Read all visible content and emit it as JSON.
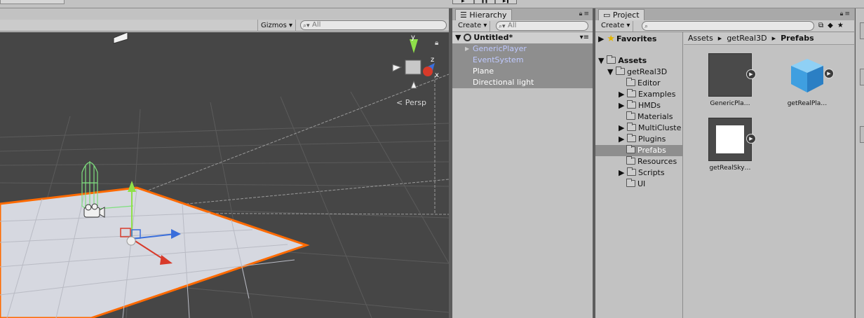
{
  "toolbar": {
    "play_icons": [
      "▶",
      "❚❚",
      "▶❚"
    ]
  },
  "scene": {
    "gizmos_label": "Gizmos",
    "search_placeholder": "All",
    "persp_label": "Persp",
    "axis_labels": {
      "y": "y",
      "z": "z",
      "x": "x"
    }
  },
  "hierarchy": {
    "tab_label": "Hierarchy",
    "create_label": "Create",
    "search_placeholder": "All",
    "scene_name": "Untitled*",
    "items": [
      {
        "label": "GenericPlayer",
        "prefab": true,
        "expandable": true
      },
      {
        "label": "EventSystem",
        "prefab": true,
        "expandable": false
      },
      {
        "label": "Plane",
        "prefab": false,
        "expandable": false
      },
      {
        "label": "Directional light",
        "prefab": false,
        "expandable": false
      }
    ]
  },
  "project": {
    "tab_label": "Project",
    "create_label": "Create",
    "favorites_label": "Favorites",
    "assets_label": "Assets",
    "tree": {
      "root": "getReal3D",
      "children": [
        {
          "label": "Editor",
          "expandable": false
        },
        {
          "label": "Examples",
          "expandable": true
        },
        {
          "label": "HMDs",
          "expandable": true
        },
        {
          "label": "Materials",
          "expandable": false
        },
        {
          "label": "MultiCluste",
          "expandable": true
        },
        {
          "label": "Plugins",
          "expandable": true
        },
        {
          "label": "Prefabs",
          "expandable": false,
          "selected": true
        },
        {
          "label": "Resources",
          "expandable": false
        },
        {
          "label": "Scripts",
          "expandable": true
        },
        {
          "label": "UI",
          "expandable": false
        }
      ]
    },
    "breadcrumb": [
      "Assets",
      "getReal3D",
      "Prefabs"
    ],
    "assets": [
      {
        "label": "GenericPla…",
        "kind": "dark-prefab"
      },
      {
        "label": "getRealPla…",
        "kind": "cube-prefab"
      },
      {
        "label": "getRealSky…",
        "kind": "white-prefab"
      }
    ]
  },
  "colors": {
    "viewport_bg": "#464646",
    "plane": "#d6d8e0",
    "selection_outline": "#ff6a00",
    "selected_row": "#8e8e8e",
    "prefab_text": "#bfc9ff",
    "cube": "#3fa4e6"
  }
}
